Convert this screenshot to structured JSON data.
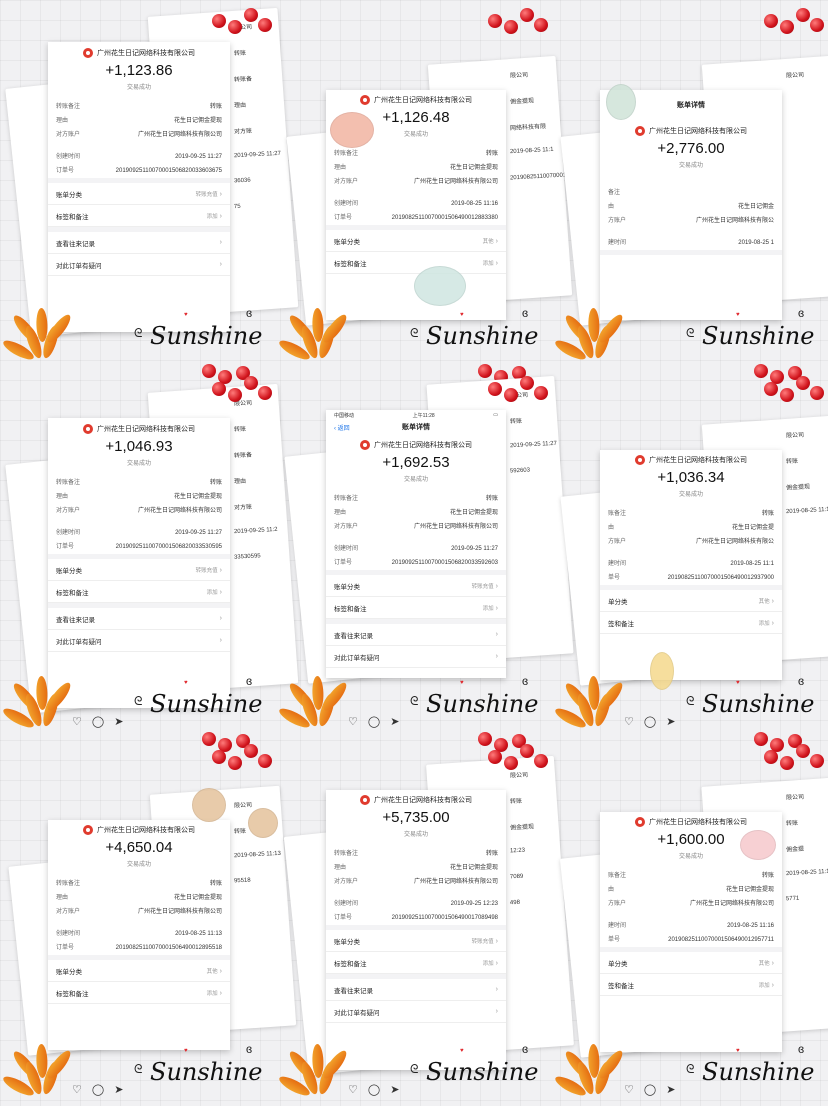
{
  "brand_text": "Sunshine",
  "tiles": [
    {
      "company": "广州花生日记网络科技有限公司",
      "amount": "+1,123.86",
      "status": "交易成功",
      "rows": [
        [
          "转账备注",
          "转账"
        ],
        [
          "理由",
          "花生日记佣金提现"
        ],
        [
          "对方账户",
          "广州花生日记网络科技有限公司"
        ],
        [
          "gap",
          ""
        ],
        [
          "创建时间",
          "2019-09-25 11:27"
        ],
        [
          "订单号",
          "20190925110070001506820033603675"
        ]
      ],
      "menus": [
        [
          "账单分类",
          "转账充值"
        ],
        [
          "标签和备注",
          "添加"
        ],
        [
          "div",
          ""
        ],
        [
          "查看往来记录",
          ""
        ],
        [
          "对此订单有疑问",
          ""
        ]
      ],
      "bg_labels": [
        "限公司",
        "转账",
        "转账备",
        "理由",
        "对方账",
        "2019-09-25 11:27",
        "36036",
        "75"
      ]
    },
    {
      "company": "广州花生日记网络科技有限公司",
      "amount": "+1,126.48",
      "status": "交易成功",
      "rows": [
        [
          "转账备注",
          "转账"
        ],
        [
          "理由",
          "花生日记佣金提现"
        ],
        [
          "对方账户",
          "广州花生日记网络科技有限公司"
        ],
        [
          "gap",
          ""
        ],
        [
          "创建时间",
          "2019-08-25 11:16"
        ],
        [
          "订单号",
          "20190825110070001506490012883380"
        ]
      ],
      "menus": [
        [
          "账单分类",
          "其他"
        ],
        [
          "标签和备注",
          "添加"
        ]
      ],
      "bg_labels": [
        "限公司",
        "佣金提现",
        "网络科技有限",
        "2019-08-25 11:1",
        "20190825110070001"
      ]
    },
    {
      "nav_title": "账单详情",
      "company": "广州花生日记网络科技有限公司",
      "amount": "+2,776.00",
      "status": "交易成功",
      "rows": [
        [
          "gap",
          ""
        ],
        [
          "备注",
          ""
        ],
        [
          "由",
          "花生日记佣金"
        ],
        [
          "方账户",
          "广州花生日记网络科技有限公"
        ],
        [
          "gap",
          ""
        ],
        [
          "建时间",
          "2019-08-25 1"
        ]
      ],
      "menus": [],
      "bg_labels": [
        "限公司"
      ]
    },
    {
      "company": "广州花生日记网络科技有限公司",
      "amount": "+1,046.93",
      "status": "交易成功",
      "rows": [
        [
          "转账备注",
          "转账"
        ],
        [
          "理由",
          "花生日记佣金提现"
        ],
        [
          "对方账户",
          "广州花生日记网络科技有限公司"
        ],
        [
          "gap",
          ""
        ],
        [
          "创建时间",
          "2019-09-25 11:27"
        ],
        [
          "订单号",
          "20190925110070001506820033530595"
        ]
      ],
      "menus": [
        [
          "账单分类",
          "转账充值"
        ],
        [
          "标签和备注",
          "添加"
        ],
        [
          "div",
          ""
        ],
        [
          "查看往来记录",
          ""
        ],
        [
          "对此订单有疑问",
          ""
        ]
      ],
      "bg_labels": [
        "限公司",
        "转账",
        "转账备",
        "理由",
        "对方账",
        "2019-09-25 11:2",
        "33530595"
      ]
    },
    {
      "status_left": "中国移动",
      "status_time": "上午11:28",
      "nav_back": "返回",
      "nav_title": "账单详情",
      "company": "广州花生日记网络科技有限公司",
      "amount": "+1,692.53",
      "status": "交易成功",
      "rows": [
        [
          "转账备注",
          "转账"
        ],
        [
          "理由",
          "花生日记佣金提现"
        ],
        [
          "对方账户",
          "广州花生日记网络科技有限公司"
        ],
        [
          "gap",
          ""
        ],
        [
          "创建时间",
          "2019-09-25 11:27"
        ],
        [
          "订单号",
          "20190925110070001506820033592603"
        ]
      ],
      "menus": [
        [
          "账单分类",
          "转账充值"
        ],
        [
          "标签和备注",
          "添加"
        ],
        [
          "div",
          ""
        ],
        [
          "查看往来记录",
          ""
        ],
        [
          "对此订单有疑问",
          ""
        ]
      ],
      "bg_labels": [
        "限公司",
        "转账",
        "2019-09-25 11:27",
        "592603"
      ]
    },
    {
      "company": "广州花生日记网络科技有限公司",
      "amount": "+1,036.34",
      "status": "交易成功",
      "rows": [
        [
          "账备注",
          "转账"
        ],
        [
          "由",
          "花生日记佣金提"
        ],
        [
          "方账户",
          "广州花生日记网络科技有限公"
        ],
        [
          "gap",
          ""
        ],
        [
          "建时间",
          "2019-08-25 11:1"
        ],
        [
          "单号",
          "20190825110070001506490012937900"
        ]
      ],
      "menus": [
        [
          "单分类",
          "其他"
        ],
        [
          "签和备注",
          "添加"
        ]
      ],
      "bg_labels": [
        "限公司",
        "转账",
        "佣金提现",
        "2019-08-25 11:1"
      ]
    },
    {
      "company": "广州花生日记网络科技有限公司",
      "amount": "+4,650.04",
      "status": "交易成功",
      "rows": [
        [
          "转账备注",
          "转账"
        ],
        [
          "理由",
          "花生日记佣金提现"
        ],
        [
          "对方账户",
          "广州花生日记网络科技有限公司"
        ],
        [
          "gap",
          ""
        ],
        [
          "创建时间",
          "2019-08-25 11:13"
        ],
        [
          "订单号",
          "20190825110070001506490012895518"
        ]
      ],
      "menus": [
        [
          "账单分类",
          "其他"
        ],
        [
          "标签和备注",
          "添加"
        ]
      ],
      "bg_labels": [
        "限公司",
        "转账",
        "2019-08-25 11:13",
        "95518"
      ]
    },
    {
      "company": "广州花生日记网络科技有限公司",
      "amount": "+5,735.00",
      "status": "交易成功",
      "rows": [
        [
          "转账备注",
          "转账"
        ],
        [
          "理由",
          "花生日记佣金提现"
        ],
        [
          "对方账户",
          "广州花生日记网络科技有限公司"
        ],
        [
          "gap",
          ""
        ],
        [
          "创建时间",
          "2019-09-25 12:23"
        ],
        [
          "订单号",
          "20190925110070001506490017089498"
        ]
      ],
      "menus": [
        [
          "账单分类",
          "转账充值"
        ],
        [
          "标签和备注",
          "添加"
        ],
        [
          "div",
          ""
        ],
        [
          "查看往来记录",
          ""
        ],
        [
          "对此订单有疑问",
          ""
        ]
      ],
      "bg_labels": [
        "限公司",
        "转账",
        "佣金提现",
        "12:23",
        "7089",
        "498"
      ]
    },
    {
      "company": "广州花生日记网络科技有限公司",
      "amount": "+1,600.00",
      "status": "交易成功",
      "rows": [
        [
          "账备注",
          "转账"
        ],
        [
          "由",
          "花生日记佣金提现"
        ],
        [
          "方账户",
          "广州花生日记网络科技有限公司"
        ],
        [
          "gap",
          ""
        ],
        [
          "建时间",
          "2019-08-25 11:16"
        ],
        [
          "单号",
          "20190825110070001506490012957711"
        ]
      ],
      "menus": [
        [
          "单分类",
          "其他"
        ],
        [
          "签和备注",
          "添加"
        ]
      ],
      "bg_labels": [
        "限公司",
        "转账",
        "佣金提",
        "2019-08-25 11:1",
        "5771"
      ]
    }
  ],
  "colors": {
    "accent_red": "#e03b2e",
    "leaf_orange": "#ee8a1e",
    "cherry_red": "#d0121b"
  },
  "icon_names": [
    "heart-outline-icon",
    "comment-icon",
    "send-icon",
    "chevron-right-icon"
  ]
}
